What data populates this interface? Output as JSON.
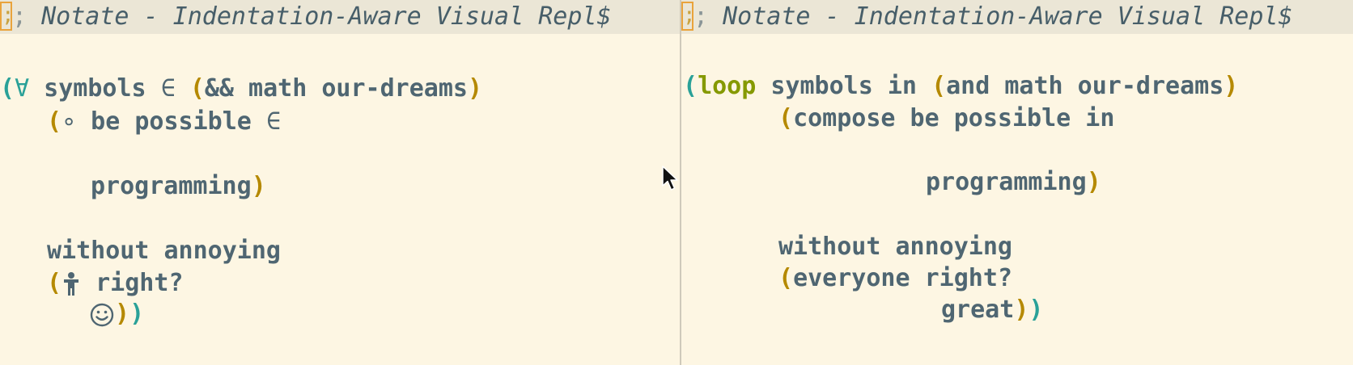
{
  "left_pane": {
    "header": {
      "comment_marker": ";",
      "cursor_char": ";",
      "title": "Notate - Indentation-Aware Visual Repl$"
    },
    "lines": {
      "l1_open_paren": "(",
      "l1_forall": "∀",
      "l1_symbols": " symbols ",
      "l1_in": "∈",
      "l1_space": " ",
      "l1_open2": "(",
      "l1_and": "&&",
      "l1_rest": " math our-dreams",
      "l1_close": ")",
      "l2_open": "(",
      "l2_compose": "∘",
      "l2_rest": " be possible ",
      "l2_in": "∈",
      "l3_text": "programming",
      "l3_close": ")",
      "l4_text": "without annoying",
      "l5_open": "(",
      "l5_rest": " right?",
      "l6_close1": ")",
      "l6_close2": ")"
    }
  },
  "right_pane": {
    "header": {
      "comment_marker": ";",
      "cursor_char": ";",
      "title": "Notate - Indentation-Aware Visual Repl$"
    },
    "lines": {
      "l1_open": "(",
      "l1_loop": "loop",
      "l1_symbols": " symbols in ",
      "l1_open2": "(",
      "l1_rest": "and math our-dreams",
      "l1_close": ")",
      "l2_open": "(",
      "l2_rest": "compose be possible in",
      "l3_text": "programming",
      "l3_close": ")",
      "l4_text": "without annoying",
      "l5_open": "(",
      "l5_rest": "everyone right?",
      "l6_text": "great",
      "l6_close1": ")",
      "l6_close2": ")"
    }
  },
  "icons": {
    "person": "person-icon",
    "smiley": "smiley-icon",
    "mouse": "mouse-pointer-icon"
  },
  "colors": {
    "background": "#fdf6e3",
    "header_bg": "#ebe6d6",
    "text": "#4f6672",
    "paren_teal": "#2aa198",
    "paren_gold": "#b58900",
    "keyword": "#859900"
  }
}
